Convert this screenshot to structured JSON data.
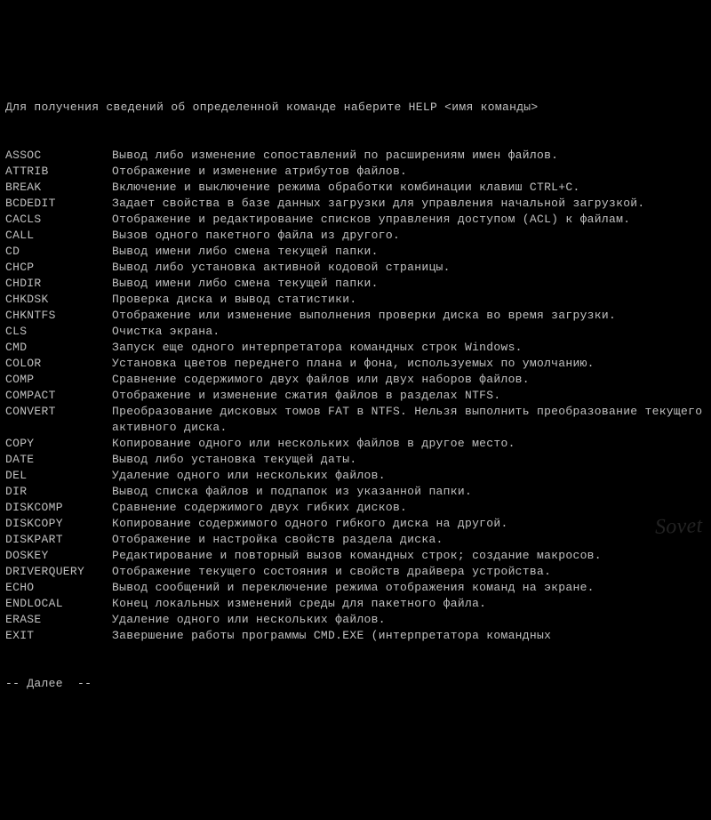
{
  "header": "Для получения сведений об определенной команде наберите HELP <имя команды>",
  "commands": [
    {
      "name": "ASSOC",
      "desc": "Вывод либо изменение сопоставлений по расширениям имен файлов."
    },
    {
      "name": "ATTRIB",
      "desc": "Отображение и изменение атрибутов файлов."
    },
    {
      "name": "BREAK",
      "desc": "Включение и выключение режима обработки комбинации клавиш CTRL+C."
    },
    {
      "name": "BCDEDIT",
      "desc": "Задает свойства в базе данных загрузки для управления начальной загрузкой."
    },
    {
      "name": "CACLS",
      "desc": "Отображение и редактирование списков управления доступом (ACL) к файлам."
    },
    {
      "name": "CALL",
      "desc": "Вызов одного пакетного файла из другого."
    },
    {
      "name": "CD",
      "desc": "Вывод имени либо смена текущей папки."
    },
    {
      "name": "CHCP",
      "desc": "Вывод либо установка активной кодовой страницы."
    },
    {
      "name": "CHDIR",
      "desc": "Вывод имени либо смена текущей папки."
    },
    {
      "name": "CHKDSK",
      "desc": "Проверка диска и вывод статистики."
    },
    {
      "name": "CHKNTFS",
      "desc": "Отображение или изменение выполнения проверки диска во время загрузки."
    },
    {
      "name": "CLS",
      "desc": "Очистка экрана."
    },
    {
      "name": "CMD",
      "desc": "Запуск еще одного интерпретатора командных строк Windows."
    },
    {
      "name": "COLOR",
      "desc": "Установка цветов переднего плана и фона, используемых по умолчанию."
    },
    {
      "name": "COMP",
      "desc": "Сравнение содержимого двух файлов или двух наборов файлов."
    },
    {
      "name": "COMPACT",
      "desc": "Отображение и изменение сжатия файлов в разделах NTFS."
    },
    {
      "name": "CONVERT",
      "desc": "Преобразование дисковых томов FAT в NTFS. Нельзя выполнить преобразование текущего активного диска."
    },
    {
      "name": "COPY",
      "desc": "Копирование одного или нескольких файлов в другое место."
    },
    {
      "name": "DATE",
      "desc": "Вывод либо установка текущей даты."
    },
    {
      "name": "DEL",
      "desc": "Удаление одного или нескольких файлов."
    },
    {
      "name": "DIR",
      "desc": "Вывод списка файлов и подпапок из указанной папки."
    },
    {
      "name": "DISKCOMP",
      "desc": "Сравнение содержимого двух гибких дисков."
    },
    {
      "name": "DISKCOPY",
      "desc": "Копирование содержимого одного гибкого диска на другой."
    },
    {
      "name": "DISKPART",
      "desc": "Отображение и настройка свойств раздела диска."
    },
    {
      "name": "DOSKEY",
      "desc": "Редактирование и повторный вызов командных строк; создание макросов."
    },
    {
      "name": "DRIVERQUERY",
      "desc": "Отображение текущего состояния и свойств драйвера устройства."
    },
    {
      "name": "ECHO",
      "desc": "Вывод сообщений и переключение режима отображения команд на экране."
    },
    {
      "name": "ENDLOCAL",
      "desc": "Конец локальных изменений среды для пакетного файла."
    },
    {
      "name": "ERASE",
      "desc": "Удаление одного или нескольких файлов."
    },
    {
      "name": "EXIT",
      "desc": "Завершение работы программы CMD.EXE (интерпретатора командных"
    }
  ],
  "more_prompt": "-- Далее  --",
  "watermark": "Sovet"
}
